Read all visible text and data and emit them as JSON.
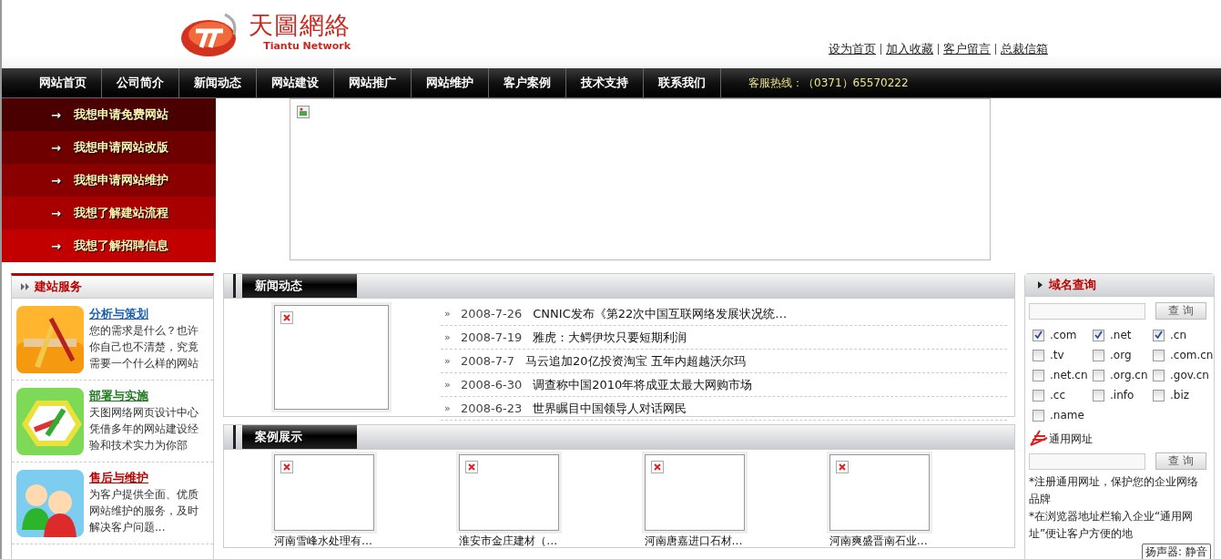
{
  "header": {
    "logo_title": "天圖網絡",
    "logo_subtitle": "Tiantu  Network",
    "links": [
      "设为首页",
      "加入收藏",
      "客户留言",
      "总裁信箱"
    ]
  },
  "nav": {
    "items": [
      "网站首页",
      "公司简介",
      "新闻动态",
      "网站建设",
      "网站推广",
      "网站维护",
      "客户案例",
      "技术支持",
      "联系我们"
    ],
    "hotline": "客服热线：（0371）65570222"
  },
  "quick_menu": [
    {
      "arrow": "→",
      "label": "我想申请免费网站"
    },
    {
      "arrow": "→",
      "label": "我想申请网站改版"
    },
    {
      "arrow": "→",
      "label": "我想申请网站维护"
    },
    {
      "arrow": "→",
      "label": "我想了解建站流程"
    },
    {
      "arrow": "→",
      "label": "我想了解招聘信息"
    }
  ],
  "services": {
    "title": "建站服务",
    "items": [
      {
        "kind": "planning",
        "title": "分析与策划",
        "color": "#1a5fb4",
        "text": "您的需求是什么？也许你自己也不清楚，究竟需要一个什么样的网站"
      },
      {
        "kind": "deploy",
        "title": "部署与实施",
        "color": "#1c7a1c",
        "text": "天图网络网页设计中心凭借多年的网站建设经验和技术实力为你部"
      },
      {
        "kind": "support",
        "title": "售后与维护",
        "color": "#b80000",
        "text": "为客户提供全面、优质网站维护的服务，及时解决客户问题..."
      }
    ]
  },
  "news": {
    "title": "新闻动态",
    "items": [
      {
        "bullet": "»",
        "date": "2008-7-26",
        "headline": "CNNIC发布《第22次中国互联网络发展状况统…"
      },
      {
        "bullet": "»",
        "date": "2008-7-19",
        "headline": "雅虎：大鳄伊坎只要短期利润"
      },
      {
        "bullet": "»",
        "date": "2008-7-7",
        "headline": "马云追加20亿投资淘宝 五年内超越沃尔玛"
      },
      {
        "bullet": "»",
        "date": "2008-6-30",
        "headline": "调查称中国2010年将成亚太最大网购市场"
      },
      {
        "bullet": "»",
        "date": "2008-6-23",
        "headline": "世界瞩目中国领导人对话网民"
      }
    ]
  },
  "cases": {
    "title": "案例展示",
    "items": [
      {
        "caption": "河南雪峰水处理有…"
      },
      {
        "caption": "淮安市金庄建材（…"
      },
      {
        "caption": "河南唐嘉进口石材…"
      },
      {
        "caption": "河南爽盛晋南石业…"
      }
    ]
  },
  "domain": {
    "title": "域名查询",
    "search_button": "查 询",
    "options": [
      {
        "label": ".com",
        "checked": true
      },
      {
        "label": ".net",
        "checked": true
      },
      {
        "label": ".cn",
        "checked": true
      },
      {
        "label": ".tv",
        "checked": false
      },
      {
        "label": ".org",
        "checked": false
      },
      {
        "label": ".com.cn",
        "checked": false
      },
      {
        "label": ".net.cn",
        "checked": false
      },
      {
        "label": ".org.cn",
        "checked": false
      },
      {
        "label": ".gov.cn",
        "checked": false
      },
      {
        "label": ".cc",
        "checked": false
      },
      {
        "label": ".info",
        "checked": false
      },
      {
        "label": ".biz",
        "checked": false
      },
      {
        "label": ".name",
        "checked": false
      }
    ],
    "keyword_label": "通用网址",
    "keyword_button": "查 询",
    "notes": [
      "*注册通用网址，保护您的企业网络品牌",
      "*在浏览器地址栏输入企业“通用网址”便让客户方便的地"
    ]
  },
  "tooltip": "扬声器: 静音"
}
